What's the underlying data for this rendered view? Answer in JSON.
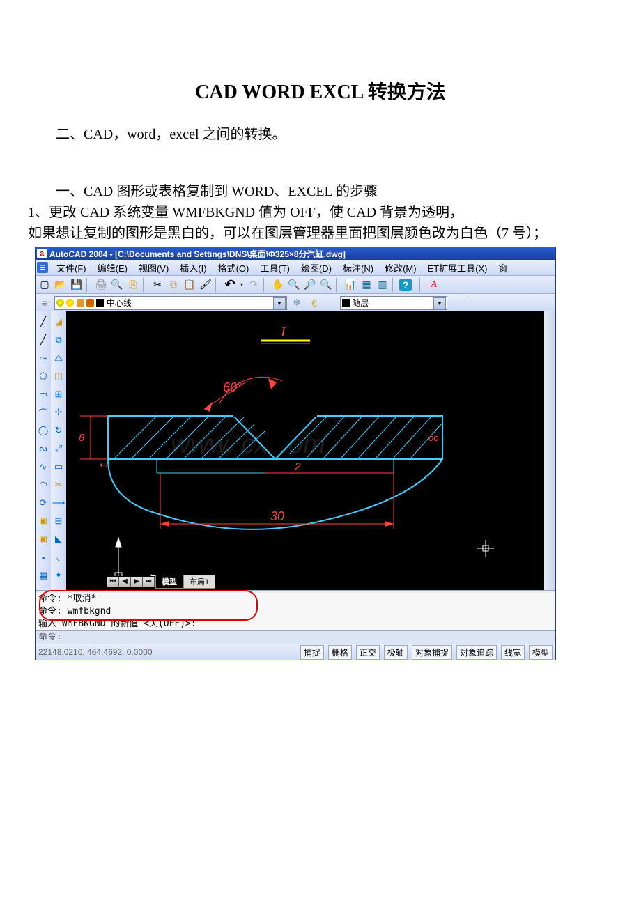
{
  "doc": {
    "title": "CAD WORD EXCL 转换方法",
    "p1": "二、CAD，word，excel 之间的转换。",
    "p2": "一、CAD 图形或表格复制到 WORD、EXCEL 的步骤",
    "p3": "1、更改 CAD 系统变量 WMFBKGND 值为 OFF，使 CAD 背景为透明，",
    "p4": "如果想让复制的图形是黑白的，可以在图层管理器里面把图层颜色改为白色（7 号）；"
  },
  "cad": {
    "title": "AutoCAD 2004 - [C:\\Documents and Settings\\DNS\\桌面\\Φ325×8分汽缸.dwg]",
    "menu": {
      "file": "文件(F)",
      "edit": "编辑(E)",
      "view": "视图(V)",
      "insert": "插入(I)",
      "format": "格式(O)",
      "tools": "工具(T)",
      "draw": "绘图(D)",
      "dim": "标注(N)",
      "modify": "修改(M)",
      "et": "ET扩展工具(X)",
      "window": "窗"
    },
    "layer": {
      "name": "中心线",
      "color_label": "随层"
    },
    "tabs": {
      "model": "模型",
      "layout1": "布局1"
    },
    "drawing": {
      "angle": "60°",
      "dim_len": "30",
      "dim_small": "2",
      "dim_8": "8",
      "dim_oo": "oo",
      "watermark": "www.       cx.com"
    },
    "cmd": {
      "l1": "命令:  *取消*",
      "l2": "命令:  wmfbkgnd",
      "l3": "输入 WMFBKGND 的新值 <关(OFF)>:",
      "prompt": "命令:"
    },
    "status": {
      "coords": "22148.0210,  464.4692,  0.0000",
      "snap": "捕捉",
      "grid": "栅格",
      "ortho": "正交",
      "polar": "极轴",
      "osnap": "对象捕捉",
      "otrack": "对象追踪",
      "lwt": "线宽",
      "model": "模型"
    }
  }
}
